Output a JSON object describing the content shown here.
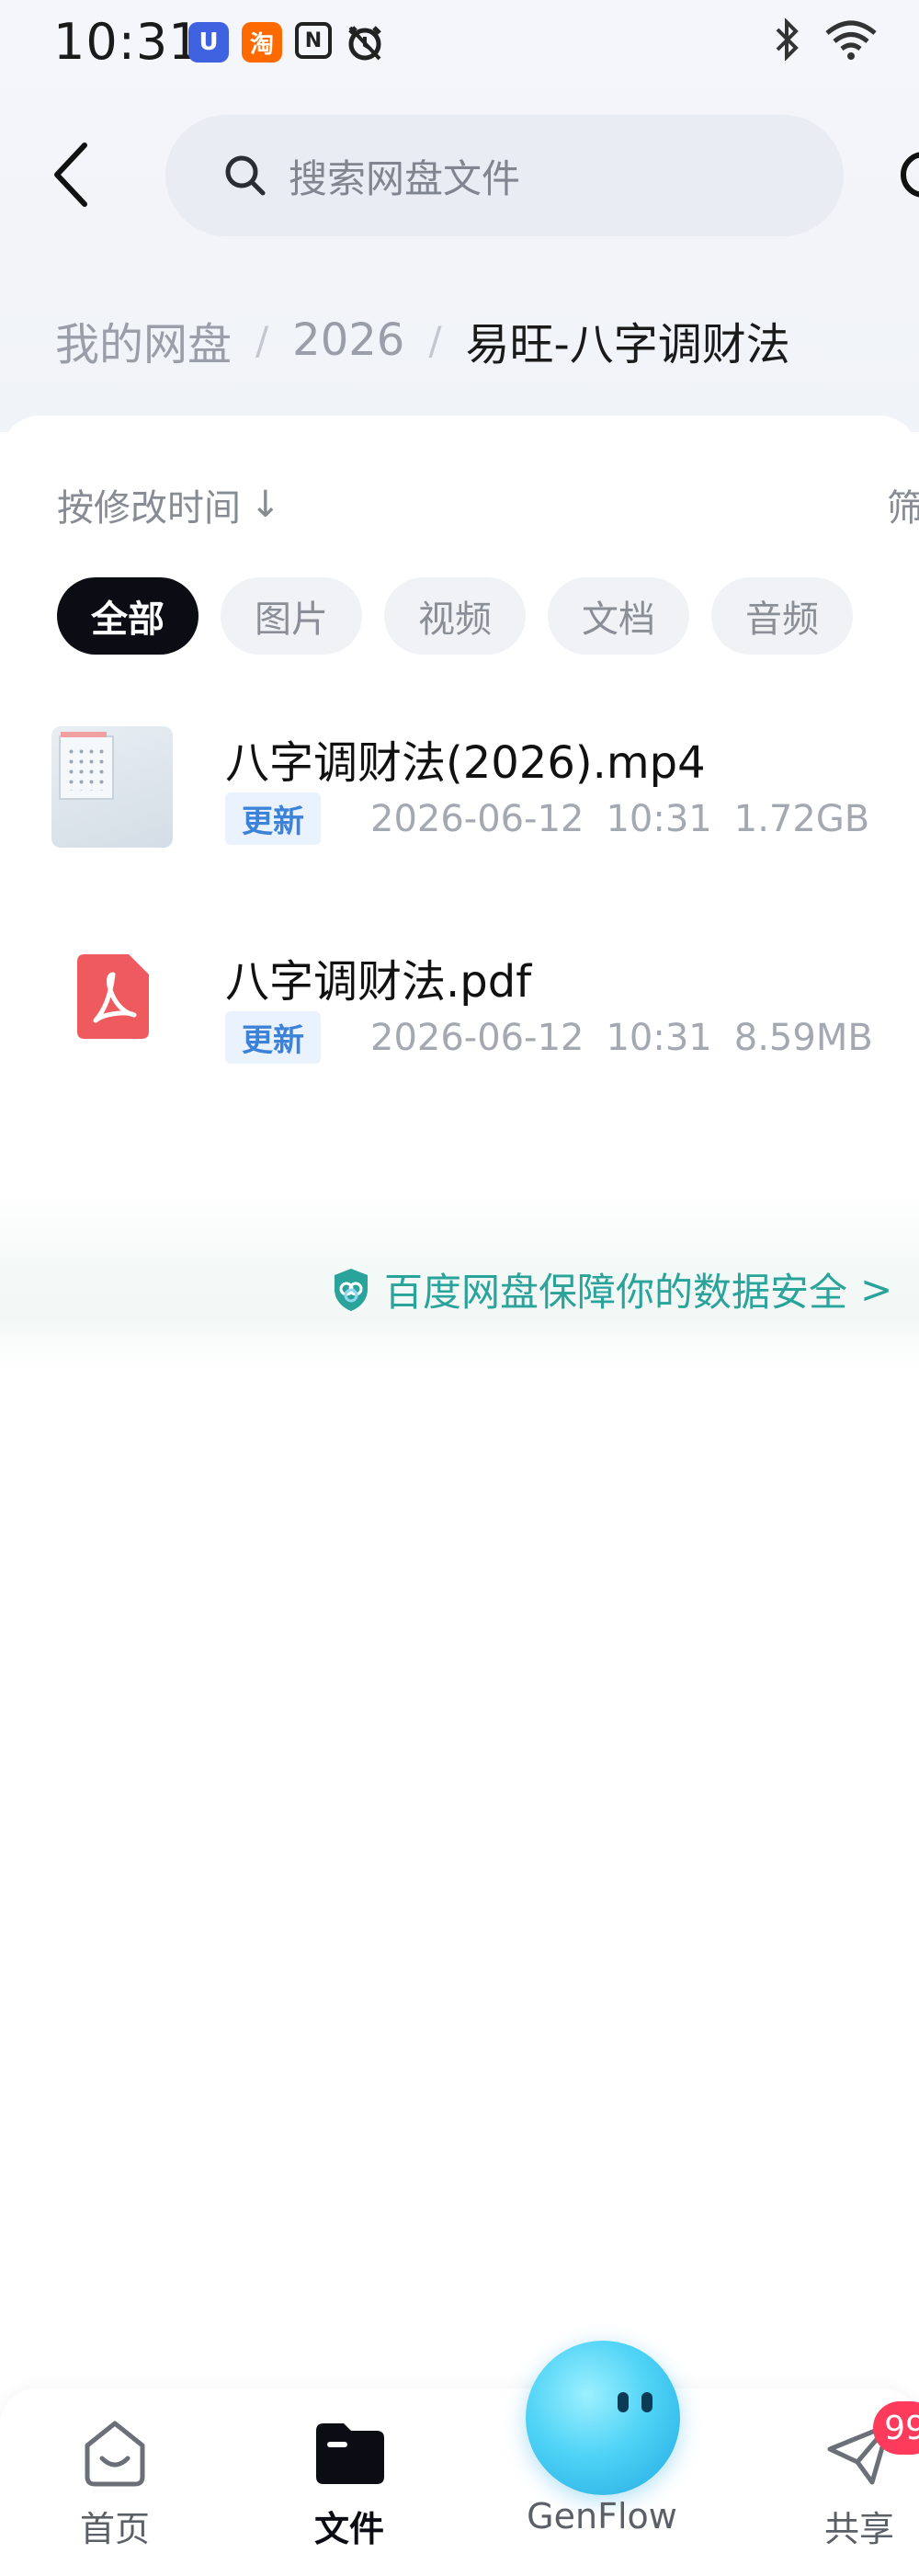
{
  "status_bar": {
    "time": "10:31",
    "apps": [
      "U",
      "淘",
      "N"
    ]
  },
  "header": {
    "search_placeholder": "搜索网盘文件"
  },
  "breadcrumb": {
    "items": [
      "我的网盘",
      "2026",
      "易旺-八字调财法"
    ],
    "separator": "/"
  },
  "toolbar": {
    "sort_label": "按修改时间",
    "sort_arrow": "↓",
    "filter_label": "筛"
  },
  "chips": [
    "全部",
    "图片",
    "视频",
    "文档",
    "音频"
  ],
  "active_chip": "全部",
  "files": [
    {
      "name": "八字调财法(2026).mp4",
      "tag": "更新",
      "date": "2026-06-12",
      "time": "10:31",
      "size": "1.72GB",
      "icon": "video-thumbnail"
    },
    {
      "name": "八字调财法.pdf",
      "tag": "更新",
      "date": "2026-06-12",
      "time": "10:31",
      "size": "8.59MB",
      "icon": "pdf-icon"
    }
  ],
  "security": {
    "text": "百度网盘保障你的数据安全",
    "arrow": ">",
    "color": "#2aa39b"
  },
  "bottom_nav": {
    "items": [
      {
        "label": "首页",
        "icon": "home-icon"
      },
      {
        "label": "文件",
        "icon": "folder-icon"
      },
      {
        "label": "GenFlow",
        "icon": "genflow-orb"
      },
      {
        "label": "共享",
        "icon": "send-icon"
      }
    ],
    "active": "文件",
    "share_badge": "99"
  },
  "colors": {
    "accent_dark": "#0b0c14",
    "update_tag": "#3b82d8",
    "badge": "#ff3b5c"
  }
}
